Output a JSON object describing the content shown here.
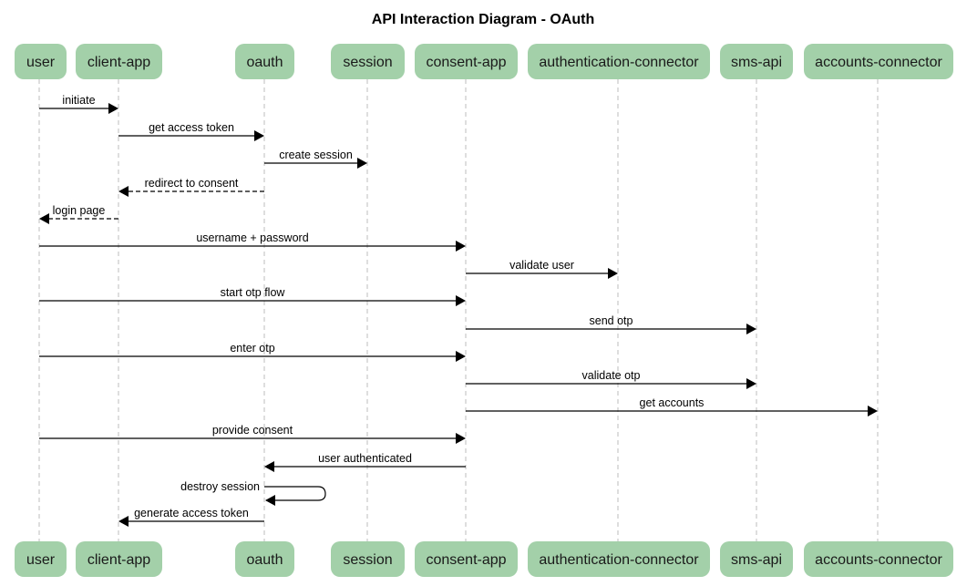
{
  "title": "API Interaction Diagram - OAuth",
  "actors": [
    {
      "id": "user",
      "label": "user"
    },
    {
      "id": "client-app",
      "label": "client-app"
    },
    {
      "id": "oauth",
      "label": "oauth"
    },
    {
      "id": "session",
      "label": "session"
    },
    {
      "id": "consent-app",
      "label": "consent-app"
    },
    {
      "id": "authentication-connector",
      "label": "authentication-connector"
    },
    {
      "id": "sms-api",
      "label": "sms-api"
    },
    {
      "id": "accounts-connector",
      "label": "accounts-connector"
    }
  ],
  "messages": [
    {
      "from": "user",
      "to": "client-app",
      "label": "initiate",
      "style": "solid"
    },
    {
      "from": "client-app",
      "to": "oauth",
      "label": "get access token",
      "style": "solid"
    },
    {
      "from": "oauth",
      "to": "session",
      "label": "create session",
      "style": "solid"
    },
    {
      "from": "oauth",
      "to": "client-app",
      "label": "redirect to consent",
      "style": "dashed"
    },
    {
      "from": "client-app",
      "to": "user",
      "label": "login page",
      "style": "dashed"
    },
    {
      "from": "user",
      "to": "consent-app",
      "label": "username + password",
      "style": "solid"
    },
    {
      "from": "consent-app",
      "to": "authentication-connector",
      "label": "validate user",
      "style": "solid"
    },
    {
      "from": "user",
      "to": "consent-app",
      "label": "start otp flow",
      "style": "solid"
    },
    {
      "from": "consent-app",
      "to": "sms-api",
      "label": "send otp",
      "style": "solid"
    },
    {
      "from": "user",
      "to": "consent-app",
      "label": "enter otp",
      "style": "solid"
    },
    {
      "from": "consent-app",
      "to": "sms-api",
      "label": "validate otp",
      "style": "solid"
    },
    {
      "from": "consent-app",
      "to": "accounts-connector",
      "label": "get accounts",
      "style": "solid"
    },
    {
      "from": "user",
      "to": "consent-app",
      "label": "provide consent",
      "style": "solid"
    },
    {
      "from": "consent-app",
      "to": "oauth",
      "label": "user authenticated",
      "style": "solid"
    },
    {
      "from": "oauth",
      "to": "oauth",
      "label": "destroy session",
      "style": "solid"
    },
    {
      "from": "oauth",
      "to": "client-app",
      "label": "generate access token",
      "style": "solid"
    }
  ]
}
